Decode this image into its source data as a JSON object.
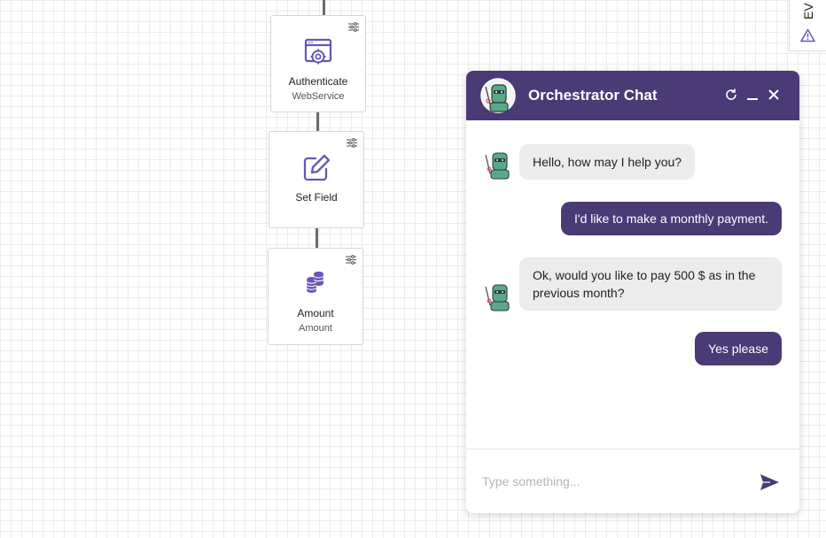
{
  "workflow": {
    "nodes": [
      {
        "title": "Authenticate",
        "subtitle": "WebService",
        "icon": "web-service-gear-icon"
      },
      {
        "title": "Set Field",
        "subtitle": "",
        "icon": "edit-icon"
      },
      {
        "title": "Amount",
        "subtitle": "Amount",
        "icon": "coins-stack-icon"
      }
    ]
  },
  "side_panel": {
    "label": "EV",
    "icon": "warning-icon"
  },
  "chat": {
    "title": "Orchestrator Chat",
    "header_buttons": [
      "refresh-icon",
      "minimize-icon",
      "close-icon"
    ],
    "messages": [
      {
        "sender": "bot",
        "text": "Hello, how may I help you?"
      },
      {
        "sender": "user",
        "text": "I'd like to make a monthly payment."
      },
      {
        "sender": "bot",
        "text": "Ok, would you like to pay 500 $ as in the previous month?"
      },
      {
        "sender": "user",
        "text": "Yes please"
      }
    ],
    "input": {
      "placeholder": "Type something...",
      "value": ""
    },
    "send_icon": "send-icon"
  },
  "colors": {
    "accent": "#4a3a75",
    "icon_purple": "#6a55b8",
    "bot_bubble": "#ececec",
    "robot_green": "#5aa88a"
  }
}
